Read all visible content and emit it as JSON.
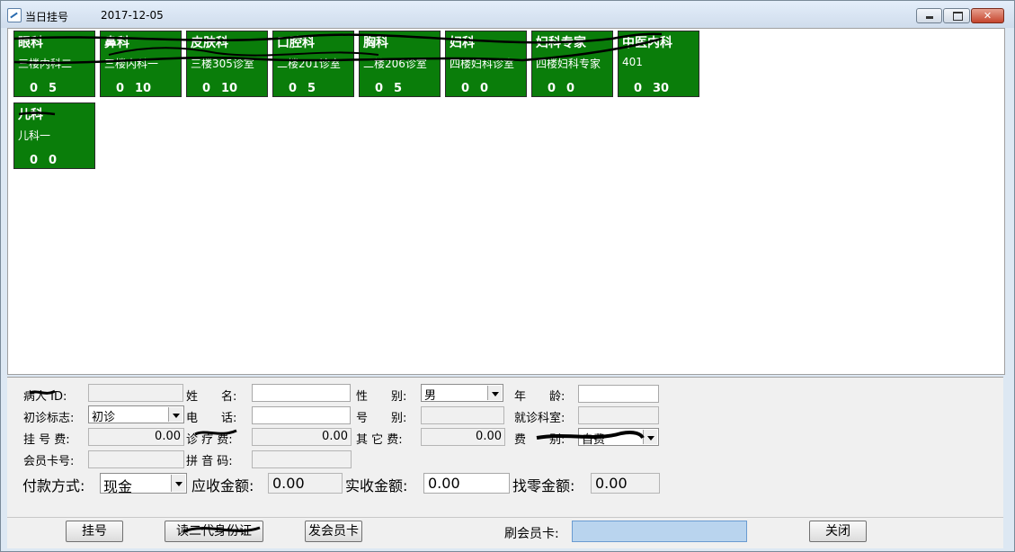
{
  "window": {
    "title": "当日挂号",
    "date": "2017-12-05"
  },
  "title_buttons": {
    "minimize": "—",
    "maximize": "□",
    "close": "✕"
  },
  "departments": [
    {
      "name": "眼科",
      "room": "三楼内科二",
      "count_a": "0",
      "count_b": "5"
    },
    {
      "name": "鼻科",
      "room": "三楼内科一",
      "count_a": "0",
      "count_b": "10"
    },
    {
      "name": "皮肤科",
      "room": "三楼305诊室",
      "count_a": "0",
      "count_b": "10"
    },
    {
      "name": "口腔科",
      "room": "二楼201诊室",
      "count_a": "0",
      "count_b": "5"
    },
    {
      "name": "胸科",
      "room": "二楼206诊室",
      "count_a": "0",
      "count_b": "5"
    },
    {
      "name": "妇科",
      "room": "四楼妇科诊室",
      "count_a": "0",
      "count_b": "0"
    },
    {
      "name": "妇科专家",
      "room": "四楼妇科专家",
      "count_a": "0",
      "count_b": "0"
    },
    {
      "name": "中医内科",
      "room": "401",
      "count_a": "0",
      "count_b": "30"
    },
    {
      "name": "儿科",
      "room": "儿科一",
      "count_a": "0",
      "count_b": "0"
    }
  ],
  "form": {
    "patient_id": {
      "label": "病人 ID:",
      "value": ""
    },
    "name": {
      "label": "姓　　名:",
      "value": ""
    },
    "sex": {
      "label": "性　　别:",
      "value": "男"
    },
    "age": {
      "label": "年　　龄:",
      "value": ""
    },
    "visit_flag": {
      "label": "初诊标志:",
      "value": "初诊"
    },
    "phone": {
      "label": "电　　话:",
      "value": ""
    },
    "number_type": {
      "label": "号　　别:",
      "value": ""
    },
    "clinic_room": {
      "label": "就诊科室:",
      "value": ""
    },
    "reg_fee": {
      "label": "挂 号 费:",
      "value": "0.00"
    },
    "diag_fee": {
      "label": "诊 疗 费:",
      "value": "0.00"
    },
    "other_fee": {
      "label": "其 它 费:",
      "value": "0.00"
    },
    "fee_type": {
      "label": "费　　别:",
      "value": "自费"
    },
    "member_card": {
      "label": "会员卡号:",
      "value": ""
    },
    "pinyin": {
      "label": "拼 音 码:",
      "value": ""
    },
    "payment": {
      "label": "付款方式:",
      "value": "现金"
    },
    "receivable": {
      "label": "应收金额:",
      "value": "0.00"
    },
    "received": {
      "label": "实收金额:",
      "value": "0.00"
    },
    "change": {
      "label": "找零金额:",
      "value": "0.00"
    }
  },
  "footer": {
    "register_button": "挂号",
    "read_id_button": "读二代身份证",
    "issue_card_button": "发会员卡",
    "swipe_label": "刷会员卡:",
    "swipe_value": "",
    "close_button": "关闭"
  }
}
